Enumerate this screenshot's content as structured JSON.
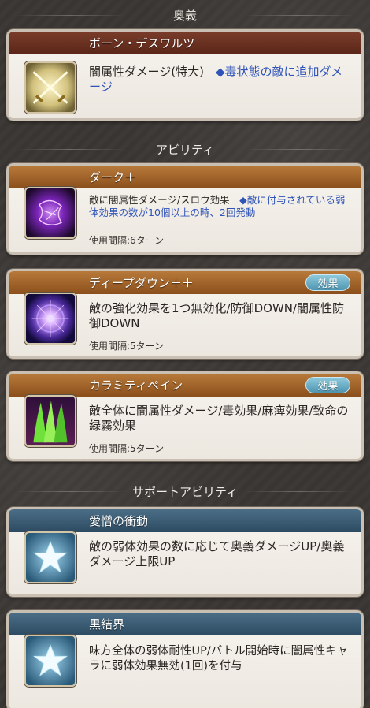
{
  "sections": {
    "ougi": "奥義",
    "ability": "アビリティ",
    "support": "サポートアビリティ"
  },
  "cards": [
    {
      "title": "ボーン・デスワルツ",
      "icon": "crossed-swords-icon",
      "desc_plain": "闇属性ダメージ(特大)　",
      "desc_highlight": "◆毒状態の敵に追加ダメージ"
    },
    {
      "title": "ダーク＋",
      "icon": "dark-burst-icon",
      "desc_plain": "敵に闇属性ダメージ/スロウ効果　",
      "desc_highlight": "◆敵に付与されている弱体効果の数が10個以上の時、2回発動",
      "cooldown": "使用間隔:6ターン"
    },
    {
      "title": "ディープダウン＋＋",
      "icon": "purple-orb-icon",
      "desc_plain": "敵の強化効果を1つ無効化/防御DOWN/闇属性防御DOWN",
      "cooldown": "使用間隔:5ターン",
      "badge": "効果"
    },
    {
      "title": "カラミティペイン",
      "icon": "green-flames-icon",
      "desc_plain": "敵全体に闇属性ダメージ/毒効果/麻痺効果/致命の緑霧効果",
      "cooldown": "使用間隔:5ターン",
      "badge": "効果"
    },
    {
      "title": "愛憎の衝動",
      "icon": "star-icon",
      "desc_plain": "敵の弱体効果の数に応じて奥義ダメージUP/奥義ダメージ上限UP"
    },
    {
      "title": "黒結界",
      "icon": "star-icon",
      "desc_plain": "味方全体の弱体耐性UP/バトル開始時に闇属性キャラに弱体効果無効(1回)を付与"
    }
  ]
}
